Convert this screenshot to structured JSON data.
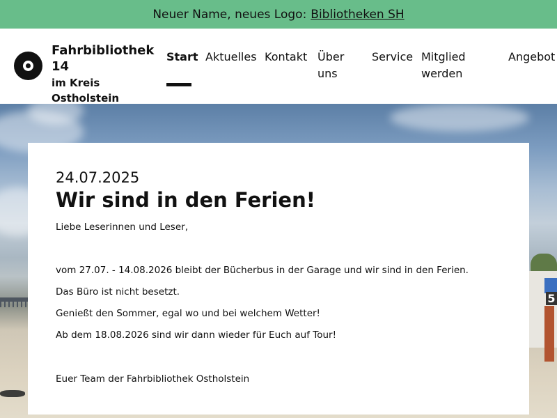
{
  "announcement": {
    "text": "Neuer Name, neues Logo:",
    "link_label": "Bibliotheken SH",
    "background": "#68bd8a"
  },
  "brand": {
    "name_line1": "Fahrbibliothek",
    "name_line2": "14",
    "subtitle": "im Kreis Ostholstein"
  },
  "nav": {
    "items": [
      {
        "label": "Start",
        "active": true
      },
      {
        "label": "Aktuelles"
      },
      {
        "label": "Kontakt"
      },
      {
        "label_line1": "Über",
        "label_line2": "uns"
      },
      {
        "label": "Service"
      },
      {
        "label_line1": "Mitglied",
        "label_line2": "werden"
      },
      {
        "label": "Angebot"
      }
    ]
  },
  "hero": {
    "chair_number": "5"
  },
  "article": {
    "date": "24.07.2025",
    "title": "Wir sind in den Ferien!",
    "paragraphs": [
      "Liebe Leserinnen und Leser,",
      "vom 27.07. - 14.08.2026 bleibt der Bücherbus in der Garage und wir sind in den Ferien.",
      "Das Büro ist nicht besetzt.",
      "Genießt den Sommer, egal wo und bei welchem Wetter!",
      "Ab dem 18.08.2026 sind wir dann wieder für Euch auf Tour!",
      "Euer Team der Fahrbibliothek Ostholstein"
    ]
  }
}
